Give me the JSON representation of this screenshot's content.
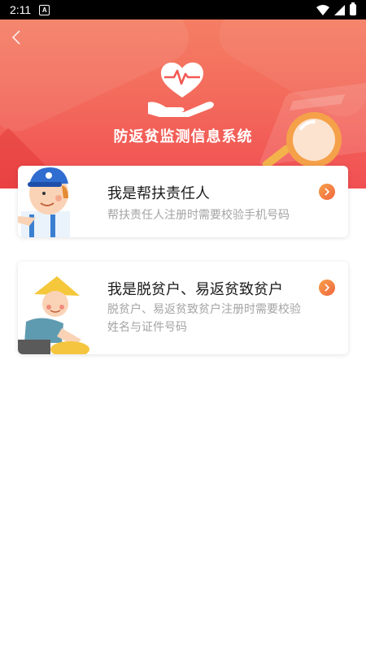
{
  "status_bar": {
    "time": "2:11",
    "app_icon": "A"
  },
  "header": {
    "title": "防返贫监测信息系统",
    "logo_icon": "heart-hand-icon",
    "back_icon": "chevron-left-icon"
  },
  "options": [
    {
      "title": "我是帮扶责任人",
      "description": "帮扶责任人注册时需要校验手机号码",
      "illustration": "worker-blue-cap"
    },
    {
      "title": "我是脱贫户、易返贫致贫户",
      "description": "脱贫户、易返贫致贫户注册时需要校验姓名与证件号码",
      "illustration": "farmer-straw-hat"
    }
  ],
  "colors": {
    "header_top": "#f57e64",
    "header_bottom": "#f14f52",
    "arrow_start": "#f6a14a",
    "arrow_end": "#f0663f",
    "desc_text": "#a4a4a4"
  }
}
